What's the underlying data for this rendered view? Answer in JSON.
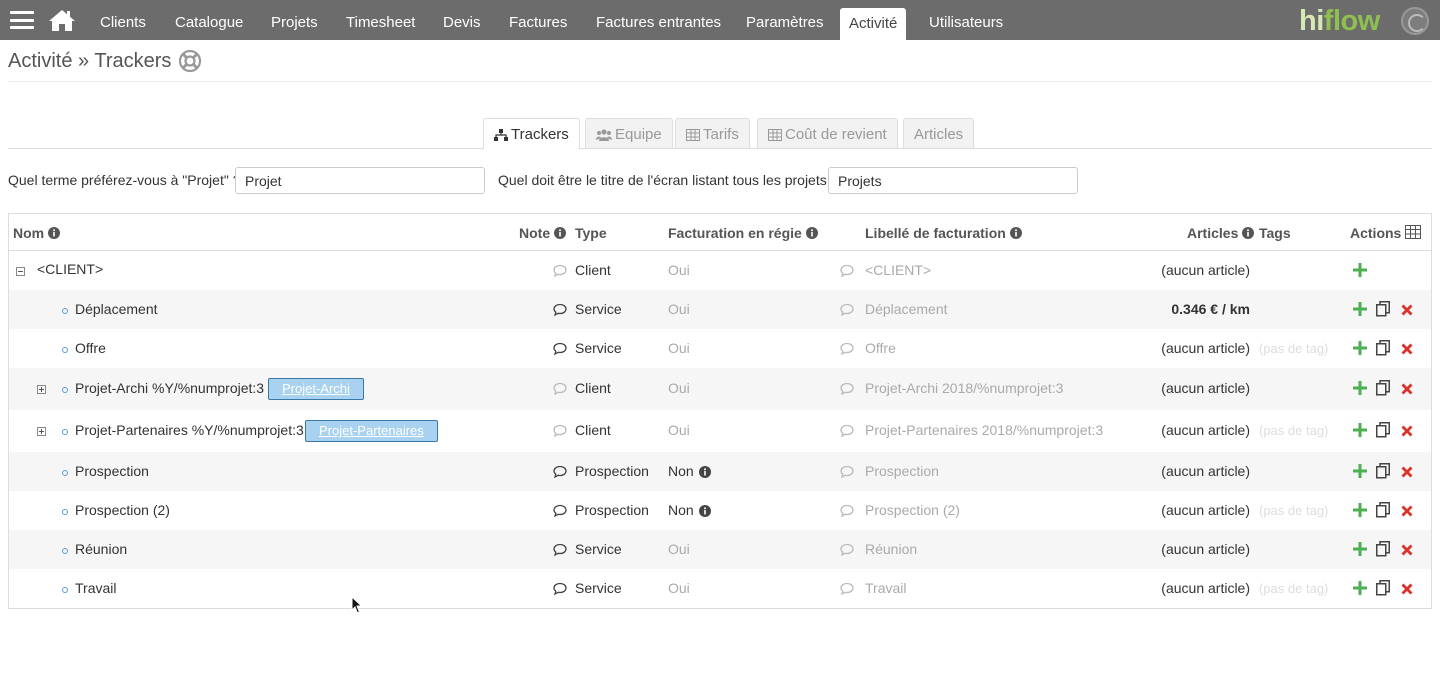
{
  "nav": {
    "items": [
      {
        "label": "Clients"
      },
      {
        "label": "Catalogue"
      },
      {
        "label": "Projets"
      },
      {
        "label": "Timesheet"
      },
      {
        "label": "Devis"
      },
      {
        "label": "Factures"
      },
      {
        "label": "Factures entrantes"
      },
      {
        "label": "Paramètres"
      },
      {
        "label": "Activité",
        "active": true
      },
      {
        "label": "Utilisateurs"
      }
    ],
    "brand_part1": "hi",
    "brand_part2": "flow"
  },
  "page": {
    "title": "Activité » Trackers"
  },
  "tabs": [
    {
      "label": "Trackers",
      "icon": "sitemap-icon",
      "active": true
    },
    {
      "label": "Equipe",
      "icon": "users-icon"
    },
    {
      "label": "Tarifs",
      "icon": "table-icon"
    },
    {
      "label": "Coût de revient",
      "icon": "calculator-icon"
    },
    {
      "label": "Articles"
    }
  ],
  "settings": {
    "term_label": "Quel terme préférez-vous à \"Projet\" ?",
    "term_value": "Projet",
    "title_label": "Quel doit être le titre de l'écran listant tous les projets ?",
    "title_value": "Projets"
  },
  "table": {
    "headers": {
      "nom": "Nom",
      "note": "Note",
      "type": "Type",
      "facturation": "Facturation en régie",
      "libelle": "Libellé de facturation",
      "articles": "Articles",
      "tags": "Tags",
      "actions": "Actions"
    },
    "rows": [
      {
        "name": "<CLIENT>",
        "type": "Client",
        "regie": "Oui",
        "libelle": "<CLIENT>",
        "articles": "(aucun article)",
        "tags": "",
        "expander": "minus"
      },
      {
        "name": "Déplacement",
        "type": "Service",
        "regie": "Oui",
        "libelle": "Déplacement",
        "articles": "0.346 € / km",
        "tags": ""
      },
      {
        "name": "Offre",
        "type": "Service",
        "regie": "Oui",
        "libelle": "Offre",
        "articles": "(aucun article)",
        "tags": "(pas de tag)"
      },
      {
        "name": "Projet-Archi %Y/%numprojet:3",
        "chip": "Projet-Archi",
        "type": "Client",
        "regie": "Oui",
        "libelle": "Projet-Archi 2018/%numprojet:3",
        "articles": "(aucun article)",
        "tags": "",
        "expander": "plus"
      },
      {
        "name": "Projet-Partenaires %Y/%numprojet:3",
        "chip": "Projet-Partenaires",
        "type": "Client",
        "regie": "Oui",
        "libelle": "Projet-Partenaires 2018/%numprojet:3",
        "articles": "(aucun article)",
        "tags": "(pas de tag)",
        "expander": "plus"
      },
      {
        "name": "Prospection",
        "type": "Prospection",
        "regie": "Non",
        "libelle": "Prospection",
        "articles": "(aucun article)",
        "tags": ""
      },
      {
        "name": "Prospection (2)",
        "type": "Prospection",
        "regie": "Non",
        "libelle": "Prospection (2)",
        "articles": "(aucun article)",
        "tags": "(pas de tag)"
      },
      {
        "name": "Réunion",
        "type": "Service",
        "regie": "Oui",
        "libelle": "Réunion",
        "articles": "(aucun article)",
        "tags": ""
      },
      {
        "name": "Travail",
        "type": "Service",
        "regie": "Oui",
        "libelle": "Travail",
        "articles": "(aucun article)",
        "tags": "(pas de tag)"
      }
    ]
  },
  "colors": {
    "nav_bg": "#6c6c6c",
    "add_green": "#4caf50",
    "delete_red": "#d9342b",
    "chip_bg": "#a8d2ef",
    "bullet_blue": "#5b9bd5"
  }
}
